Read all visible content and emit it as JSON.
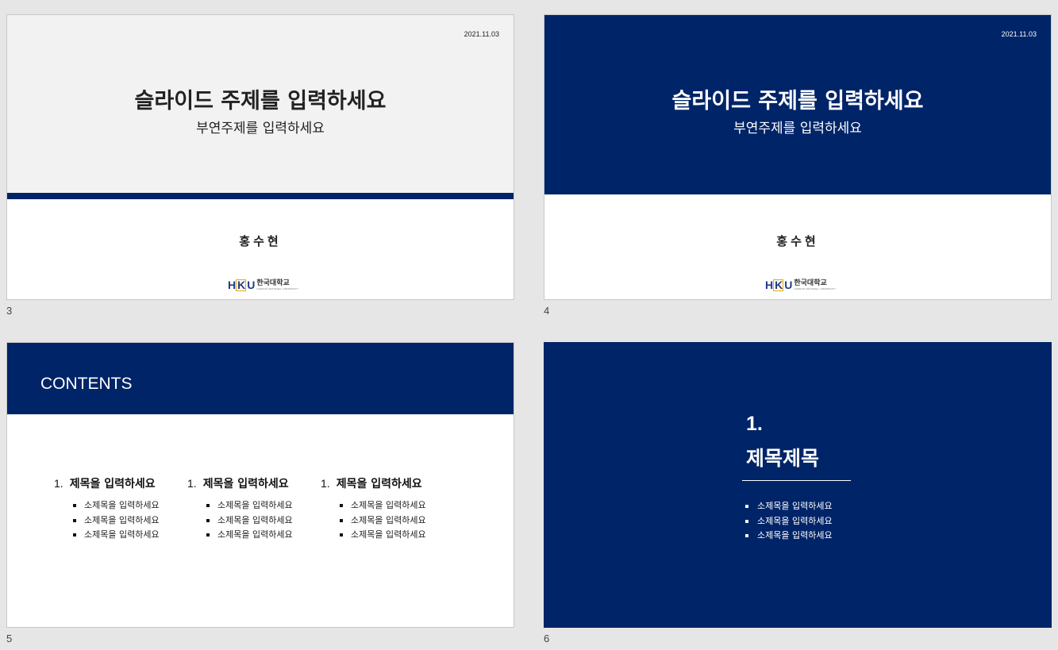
{
  "slides": [
    {
      "number": "3",
      "date": "2021.11.03",
      "title": "슬라이드 주제를 입력하세요",
      "subtitle": "부연주제를 입력하세요",
      "author": "홍수현",
      "logo_kr": "한국대학교",
      "logo_en": "HANKUK NATIONAL UNIVERSITY"
    },
    {
      "number": "4",
      "date": "2021.11.03",
      "title": "슬라이드 주제를 입력하세요",
      "subtitle": "부연주제를 입력하세요",
      "author": "홍수현",
      "logo_kr": "한국대학교",
      "logo_en": "HANKUK NATIONAL UNIVERSITY"
    },
    {
      "number": "5",
      "heading": "CONTENTS",
      "columns": [
        {
          "num": "1.",
          "title": "제목을 입력하세요",
          "items": [
            "소제목을 입력하세요",
            "소제목을 입력하세요",
            "소제목을 입력하세요"
          ]
        },
        {
          "num": "1.",
          "title": "제목을 입력하세요",
          "items": [
            "소제목을 입력하세요",
            "소제목을 입력하세요",
            "소제목을 입력하세요"
          ]
        },
        {
          "num": "1.",
          "title": "제목을 입력하세요",
          "items": [
            "소제목을 입력하세요",
            "소제목을 입력하세요",
            "소제목을 입력하세요"
          ]
        }
      ]
    },
    {
      "number": "6",
      "section_num": "1.",
      "section_title": "제목제목",
      "items": [
        "소제목을 입력하세요",
        "소제목을 입력하세요",
        "소제목을 입력하세요"
      ]
    }
  ],
  "colors": {
    "navy": "#002468",
    "light_gray": "#f2f2f2",
    "logo_accent": "#f0a500"
  }
}
